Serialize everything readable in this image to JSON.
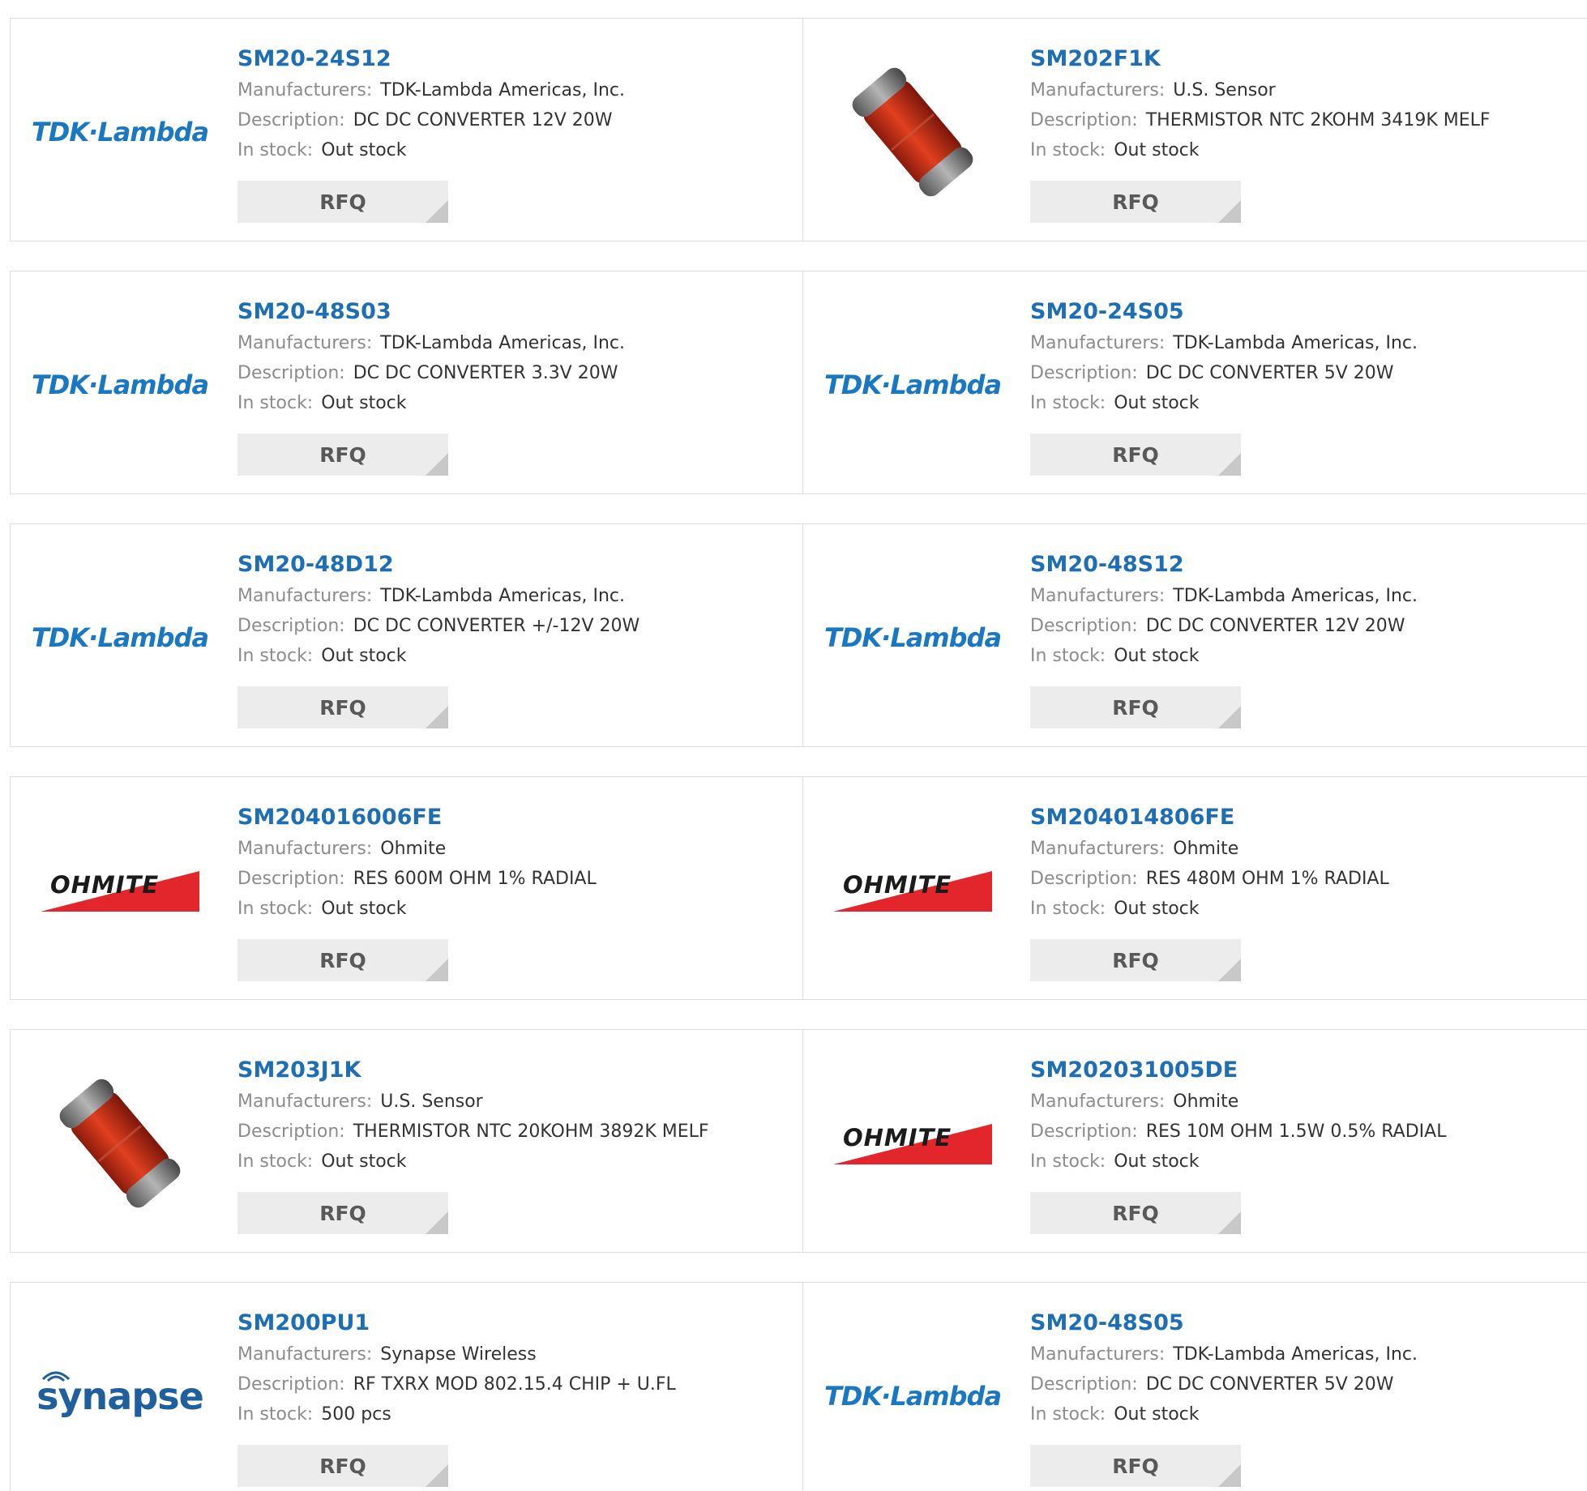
{
  "labels": {
    "manufacturers": "Manufacturers:",
    "description": "Description:",
    "in_stock": "In stock:",
    "rfq": "RFQ"
  },
  "products": [
    {
      "part": "SM20-24S12",
      "manufacturer": "TDK-Lambda Americas, Inc.",
      "description": "DC DC CONVERTER 12V 20W",
      "stock": "Out stock",
      "logo": "tdk-lambda-logo"
    },
    {
      "part": "SM202F1K",
      "manufacturer": "U.S. Sensor",
      "description": "THERMISTOR NTC 2KOHM 3419K MELF",
      "stock": "Out stock",
      "logo": "melf-thermistor-photo"
    },
    {
      "part": "SM20-48S03",
      "manufacturer": "TDK-Lambda Americas, Inc.",
      "description": "DC DC CONVERTER 3.3V 20W",
      "stock": "Out stock",
      "logo": "tdk-lambda-logo"
    },
    {
      "part": "SM20-24S05",
      "manufacturer": "TDK-Lambda Americas, Inc.",
      "description": "DC DC CONVERTER 5V 20W",
      "stock": "Out stock",
      "logo": "tdk-lambda-logo"
    },
    {
      "part": "SM20-48D12",
      "manufacturer": "TDK-Lambda Americas, Inc.",
      "description": "DC DC CONVERTER +/-12V 20W",
      "stock": "Out stock",
      "logo": "tdk-lambda-logo"
    },
    {
      "part": "SM20-48S12",
      "manufacturer": "TDK-Lambda Americas, Inc.",
      "description": "DC DC CONVERTER 12V 20W",
      "stock": "Out stock",
      "logo": "tdk-lambda-logo"
    },
    {
      "part": "SM204016006FE",
      "manufacturer": "Ohmite",
      "description": "RES 600M OHM 1% RADIAL",
      "stock": "Out stock",
      "logo": "ohmite-logo"
    },
    {
      "part": "SM204014806FE",
      "manufacturer": "Ohmite",
      "description": "RES 480M OHM 1% RADIAL",
      "stock": "Out stock",
      "logo": "ohmite-logo"
    },
    {
      "part": "SM203J1K",
      "manufacturer": "U.S. Sensor",
      "description": "THERMISTOR NTC 20KOHM 3892K MELF",
      "stock": "Out stock",
      "logo": "melf-thermistor-photo"
    },
    {
      "part": "SM202031005DE",
      "manufacturer": "Ohmite",
      "description": "RES 10M OHM 1.5W 0.5% RADIAL",
      "stock": "Out stock",
      "logo": "ohmite-logo"
    },
    {
      "part": "SM200PU1",
      "manufacturer": "Synapse Wireless",
      "description": "RF TXRX MOD 802.15.4 CHIP + U.FL",
      "stock": "500 pcs",
      "logo": "synapse-logo"
    },
    {
      "part": "SM20-48S05",
      "manufacturer": "TDK-Lambda Americas, Inc.",
      "description": "DC DC CONVERTER 5V 20W",
      "stock": "Out stock",
      "logo": "tdk-lambda-logo"
    }
  ],
  "logo_text": {
    "tdk": "TDK·Lambda",
    "ohmite": "OHMITE",
    "synapse": "synapse"
  },
  "colors": {
    "part_link": "#1d6eb5",
    "label": "#8c8c8c",
    "value": "#333333",
    "rfq_bg": "#ececec",
    "tdk_blue": "#1a78c2",
    "ohmite_red": "#e2262b",
    "synapse_blue": "#1f5f9e"
  }
}
